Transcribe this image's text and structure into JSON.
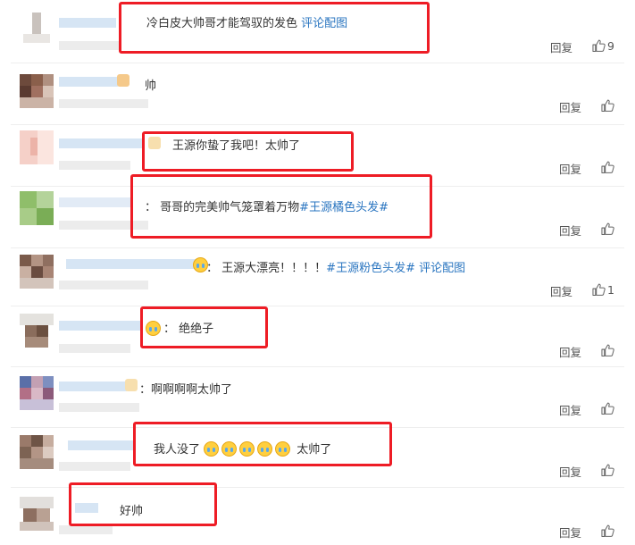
{
  "comments": [
    {
      "text": "冷白皮大帅哥才能驾驭的发色",
      "link": "评论配图",
      "reply": "回复",
      "likes": "9"
    },
    {
      "text": "帅",
      "reply": "回复"
    },
    {
      "text": "王源你蛰了我吧！太帅了",
      "reply": "回复"
    },
    {
      "prefix": "：",
      "text": "哥哥的完美帅气笼罩着万物",
      "topic": "#王源橘色头发#",
      "reply": "回复"
    },
    {
      "prefix": "：",
      "text": "王源大漂亮！！！！",
      "topic": "#王源粉色头发#",
      "link": "评论配图",
      "reply": "回复",
      "likes": "1"
    },
    {
      "prefix": "：",
      "text": "绝绝子",
      "reply": "回复"
    },
    {
      "prefix": "：",
      "text": "啊啊啊啊太帅了",
      "reply": "回复"
    },
    {
      "text_start": "我人没了",
      "text_end": "太帅了",
      "reply": "回复"
    },
    {
      "text": "好帅",
      "reply": "回复"
    }
  ],
  "colors": {
    "highlight_box": "#ee1c25",
    "link": "#2a75c0"
  },
  "icons": {
    "like": "thumbs-up-icon",
    "emoji": "crying-face-icon"
  }
}
